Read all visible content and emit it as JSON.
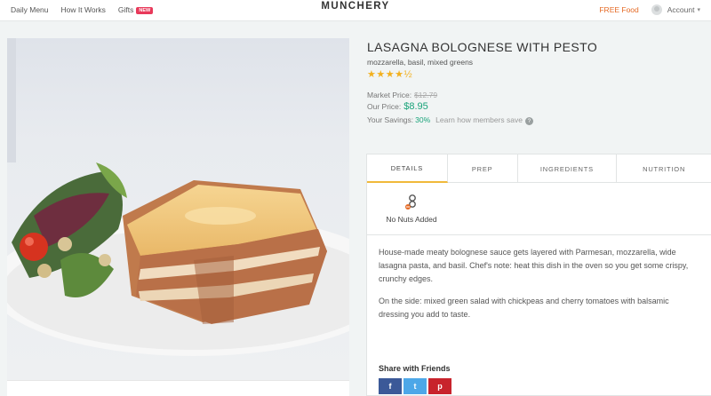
{
  "nav": {
    "daily_menu": "Daily Menu",
    "how_it_works": "How It Works",
    "gifts": "Gifts",
    "gifts_badge": "NEW",
    "logo": "MUNCHERY",
    "free_food": "FREE Food",
    "account": "Account"
  },
  "product": {
    "title": "LASAGNA BOLOGNESE WITH PESTO",
    "subtitle": "mozzarella, basil, mixed greens",
    "rating": 4.5,
    "rating_max": 5,
    "stars": "★★★★½",
    "market_price_label": "Market Price:",
    "market_price": "$12.79",
    "our_price_label": "Our Price:",
    "our_price": "$8.95",
    "savings_label": "Your Savings:",
    "savings": "30%",
    "learn_link": "Learn how members save",
    "help_icon": "?"
  },
  "tabs": [
    {
      "label": "DETAILS",
      "active": true
    },
    {
      "label": "PREP",
      "active": false
    },
    {
      "label": "INGREDIENTS",
      "active": false
    },
    {
      "label": "NUTRITION",
      "active": false
    }
  ],
  "details": {
    "diet_label": "No Nuts Added",
    "diet_icon": "no-nuts-icon",
    "paragraph1": "House-made meaty bolognese sauce gets layered with Parmesan, mozzarella, wide lasagna pasta, and basil. Chef's note: heat this dish in the oven so you get some crispy, crunchy edges.",
    "paragraph2": "On the side: mixed green salad with chickpeas and cherry tomatoes with balsamic dressing you add to taste."
  },
  "share": {
    "label": "Share with Friends",
    "facebook": "f",
    "twitter": "t",
    "pinterest": "p"
  },
  "colors": {
    "accent_green": "#1aa37a",
    "free_food_orange": "#e56a25",
    "star_yellow": "#f2b01e",
    "tab_active_underline": "#f0b93a",
    "badge_red": "#e8395a",
    "facebook": "#3b5998",
    "twitter": "#4da7e8",
    "pinterest": "#c8232c"
  }
}
